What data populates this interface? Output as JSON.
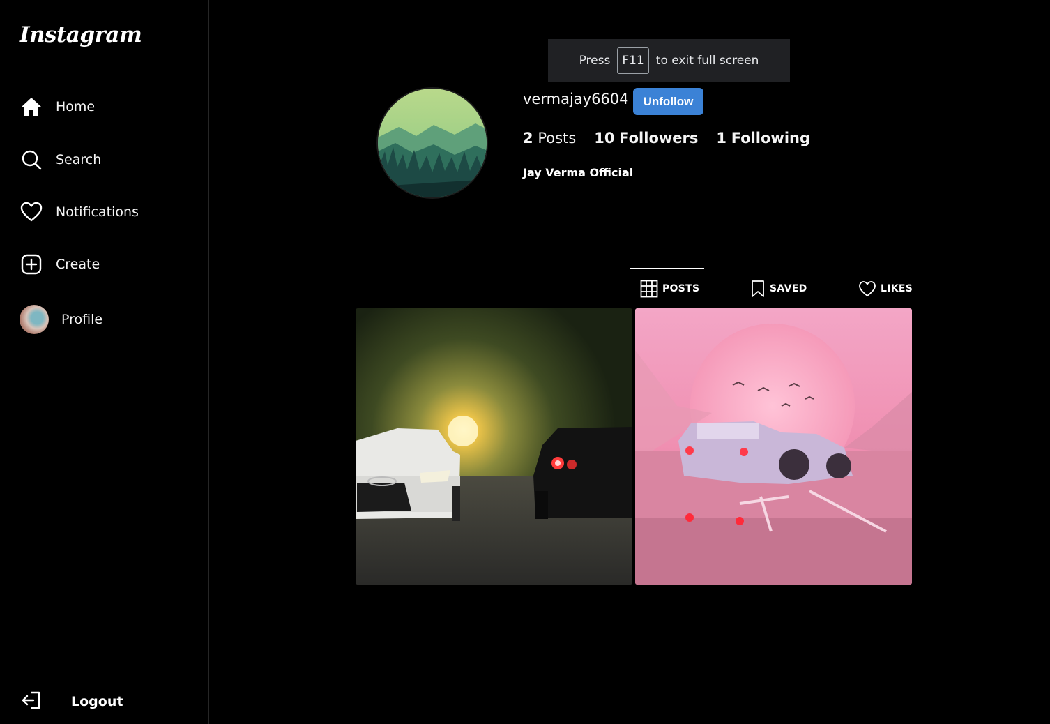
{
  "app": {
    "logo": "Instagram"
  },
  "sidebar": {
    "items": [
      {
        "label": "Home",
        "icon": "home-icon"
      },
      {
        "label": "Search",
        "icon": "search-icon"
      },
      {
        "label": "Notifications",
        "icon": "heart-icon"
      },
      {
        "label": "Create",
        "icon": "plus-square-icon"
      },
      {
        "label": "Profile",
        "icon": "avatar"
      }
    ],
    "logout_label": "Logout"
  },
  "toast": {
    "prefix": "Press",
    "key": "F11",
    "suffix": "to exit full screen"
  },
  "profile": {
    "username": "vermajay6604",
    "action_button": "Unfollow",
    "posts_count": "2",
    "posts_label": "Posts",
    "followers_count": "10",
    "followers_label": "Followers",
    "following_count": "1",
    "following_label": "Following",
    "full_name": "Jay Verma Official"
  },
  "tabs": [
    {
      "label": "POSTS",
      "icon": "grid-icon",
      "active": true
    },
    {
      "label": "SAVED",
      "icon": "bookmark-icon",
      "active": false
    },
    {
      "label": "LIKES",
      "icon": "heart-icon",
      "active": false
    }
  ],
  "colors": {
    "accent": "#3b82d6",
    "background": "#000000",
    "border": "#262626"
  }
}
